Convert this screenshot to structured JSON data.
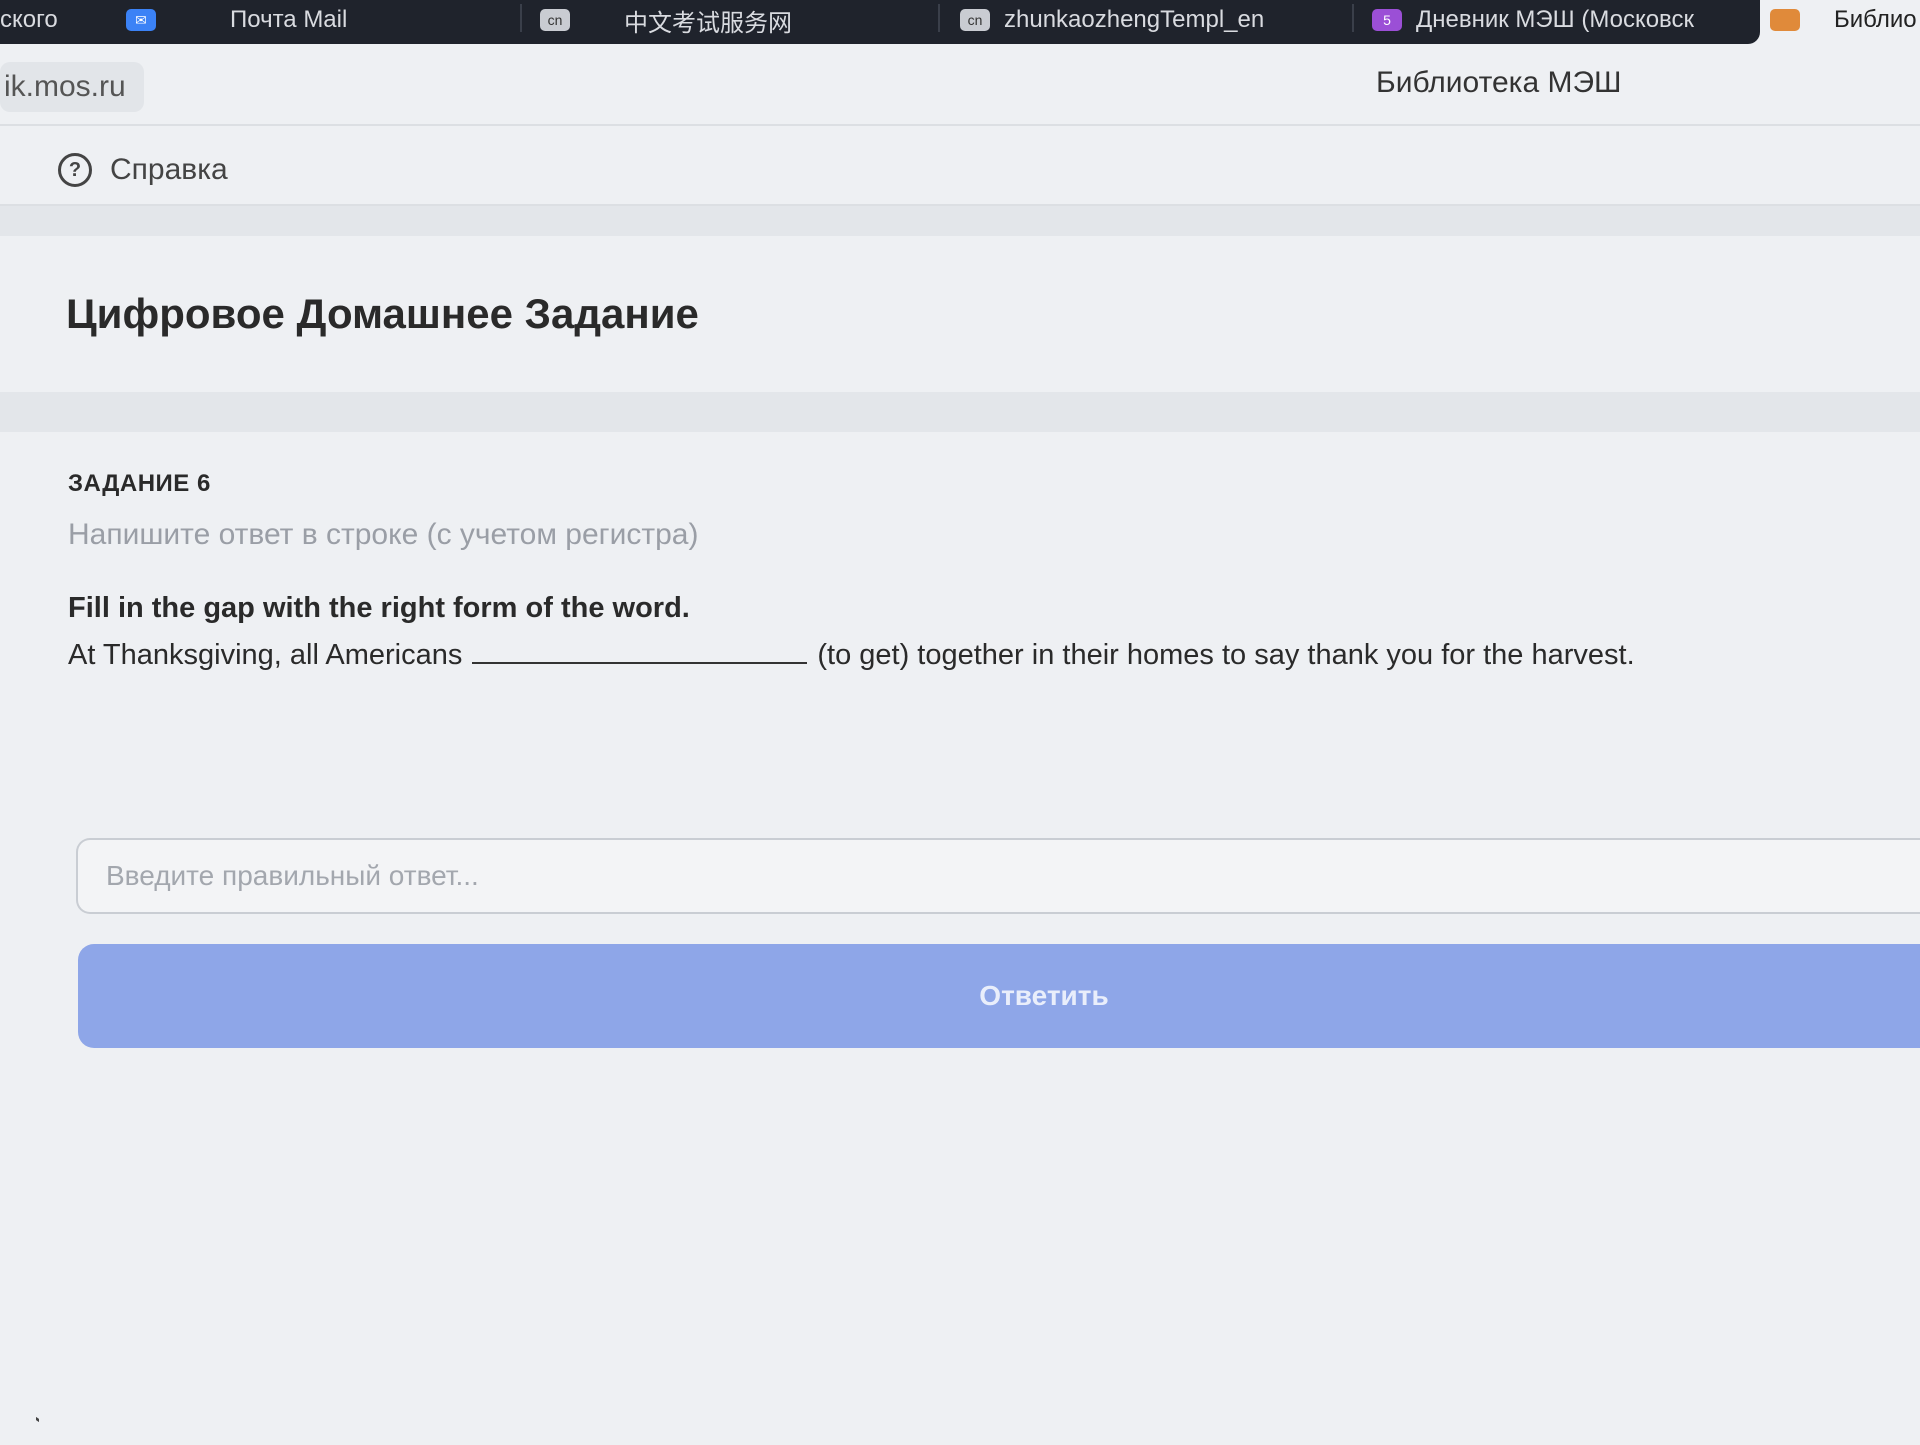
{
  "browser": {
    "tabs": [
      {
        "label": "ского",
        "icon": "none"
      },
      {
        "label": "Почта Mail",
        "icon": "mail-icon"
      },
      {
        "label": "中文考试服务网",
        "icon": "site-icon"
      },
      {
        "label": "zhunkaozhengTempl_en",
        "icon": "site-icon"
      },
      {
        "label": "Дневник МЭШ (Московск",
        "icon": "mesh-icon"
      },
      {
        "label": "Библио",
        "icon": "library-icon"
      }
    ],
    "url": "ik.mos.ru",
    "bookmark": "Библиотека МЭШ"
  },
  "header": {
    "help_label": "Справка",
    "help_icon_glyph": "?"
  },
  "page": {
    "title": "Цифровое Домашнее Задание"
  },
  "task": {
    "number_label": "ЗАДАНИЕ 6",
    "hint": "Напишите ответ в строке (с учетом регистра)",
    "instruction": "Fill in the gap with the right form of the word.",
    "sentence_before": "At Thanksgiving, all Americans",
    "sentence_after": "(to get) together in their homes to say thank you for the harvest."
  },
  "answer": {
    "placeholder": "Введите правильный ответ...",
    "value": ""
  },
  "submit": {
    "label": "Ответить"
  },
  "colors": {
    "tabstrip": "#1f232c",
    "submit_button": "#8ea6e8",
    "hint_text": "#9a9ea6"
  }
}
